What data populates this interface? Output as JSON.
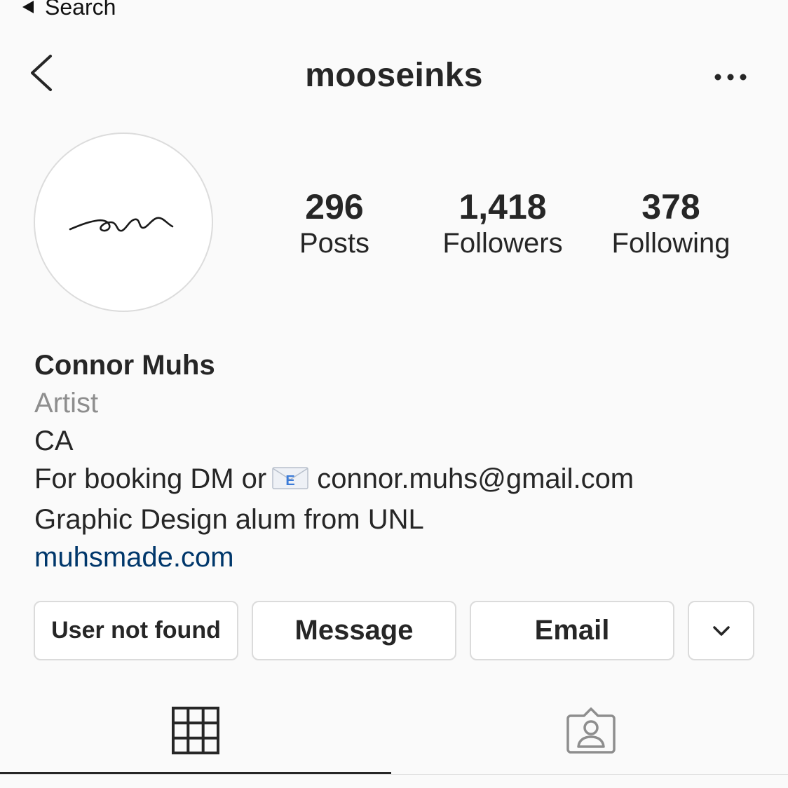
{
  "status_bar": {
    "back_label": "Search"
  },
  "header": {
    "username": "mooseinks",
    "back_icon": "chevron-left-icon",
    "more_icon": "more-horizontal-icon"
  },
  "profile": {
    "avatar_icon": "signature-logo",
    "stats": [
      {
        "value": "296",
        "label": "Posts"
      },
      {
        "value": "1,418",
        "label": "Followers"
      },
      {
        "value": "378",
        "label": "Following"
      }
    ]
  },
  "bio": {
    "name": "Connor Muhs",
    "category": "Artist",
    "location": "CA",
    "booking_prefix": "For booking DM or",
    "booking_icon": "envelope-e-icon",
    "booking_email": "connor.muhs@gmail.com",
    "education": "Graphic Design alum from UNL",
    "website": "muhsmade.com"
  },
  "actions": {
    "follow_label": "User not found",
    "message_label": "Message",
    "email_label": "Email",
    "more_icon": "chevron-down-icon"
  },
  "tabs": [
    {
      "icon": "grid-icon",
      "active": true
    },
    {
      "icon": "tagged-person-icon",
      "active": false
    }
  ],
  "colors": {
    "background": "#fafafa",
    "text": "#262626",
    "secondary_text": "#8e8e8e",
    "link": "#00376b",
    "border": "#dbdbdb"
  }
}
